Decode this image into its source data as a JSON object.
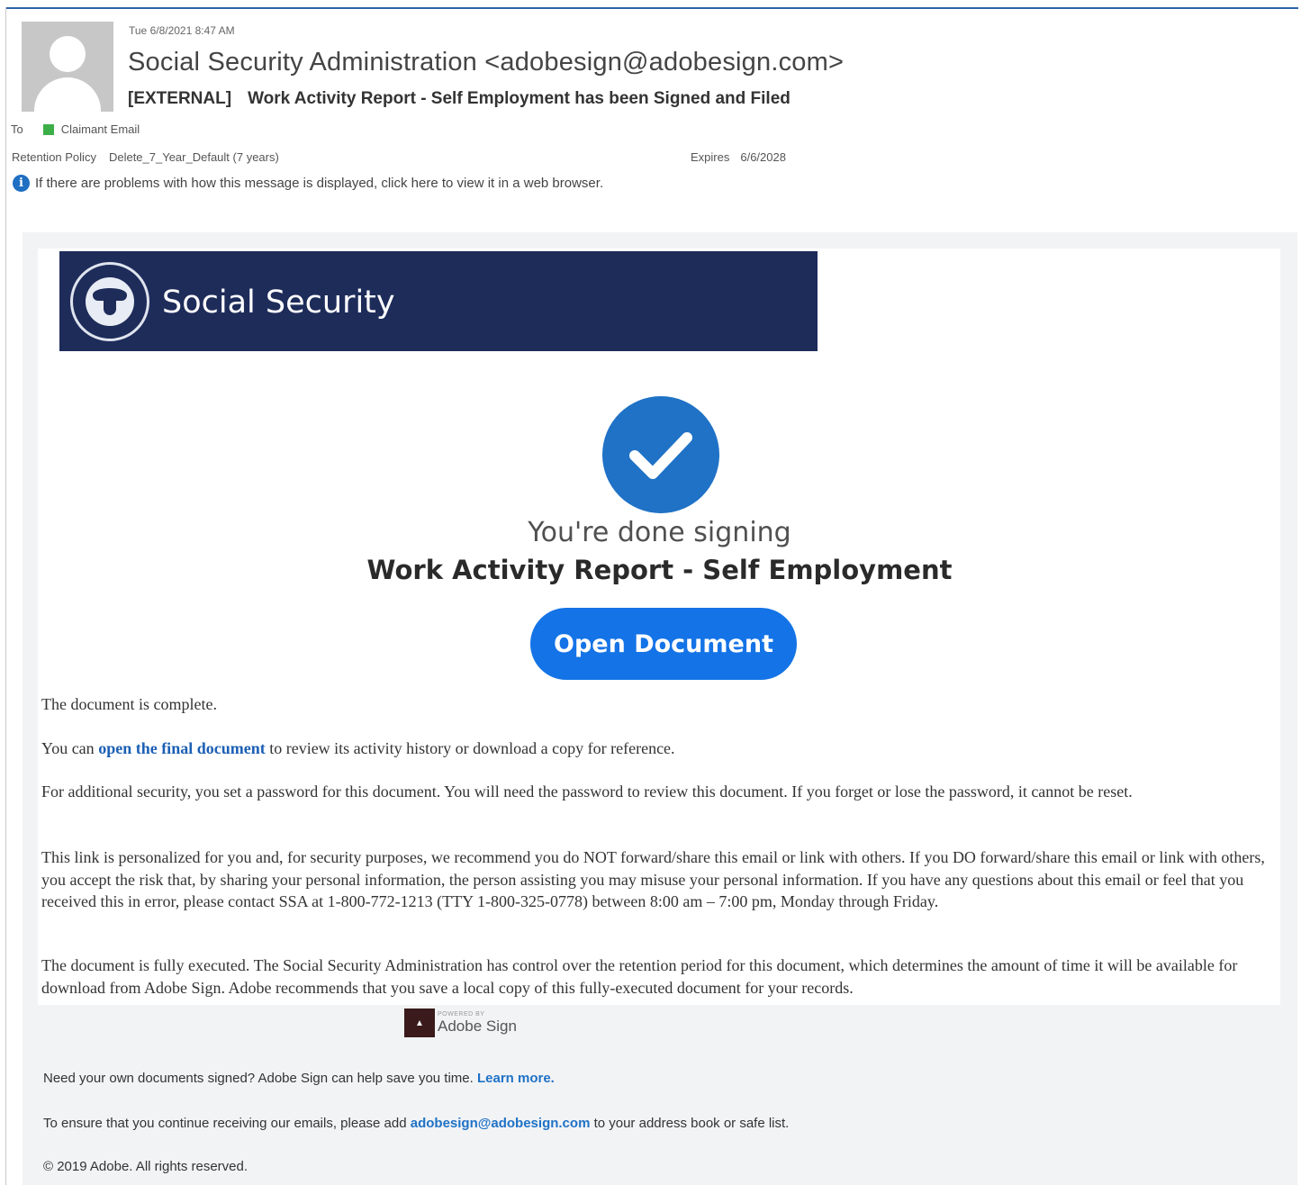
{
  "email": {
    "date": "Tue 6/8/2021 8:47 AM",
    "from": "Social Security Administration <adobesign@adobesign.com>",
    "subject_tag": "[EXTERNAL]",
    "subject": "Work Activity Report - Self Employment has been Signed and Filed",
    "to_label": "To",
    "to_value": "Claimant Email",
    "retention_label": "Retention Policy",
    "retention_value": "Delete_7_Year_Default (7 years)",
    "expires_label": "Expires",
    "expires_value": "6/6/2028",
    "info_text": "If there are problems with how this message is displayed, click here to view it in a web browser."
  },
  "banner": {
    "title": "Social Security"
  },
  "status": {
    "done_text": "You're done signing",
    "doc_title": "Work Activity Report - Self Employment",
    "open_button": "Open Document"
  },
  "body": {
    "p1": "The document is complete.",
    "p2_before": "You can ",
    "p2_link": "open the final document",
    "p2_after": " to review its activity history or download a copy for reference.",
    "p3": "For additional security, you set a password for this document. You will need the password to review this document. If you forget or lose the password, it cannot be reset.",
    "p4": "This link is personalized for you and, for security purposes, we recommend you do NOT forward/share this email or link with others. If you DO forward/share this email or link with others, you accept the risk that, by sharing your personal information, the person assisting you may misuse your personal information. If you have any questions about this email or feel that you received this in error, please contact SSA at 1-800-772-1213 (TTY 1-800-325-0778) between 8:00 am – 7:00 pm, Monday through Friday.",
    "p5": "The document is fully executed. The Social Security Administration has control over the retention period for this document, which determines the amount of time it will be available for download from Adobe Sign. Adobe recommends that you save a local copy of this fully-executed document for your records."
  },
  "footer": {
    "powered_by": "POWERED BY",
    "brand": "Adobe Sign",
    "need_text": "Need your own documents signed? Adobe Sign can help save you time. ",
    "learn_more": "Learn more.",
    "ensure_before": "To ensure that you continue receiving our emails, please add ",
    "ensure_link": "adobesign@adobesign.com",
    "ensure_after": " to your address book or safe list.",
    "copyright": "© 2019 Adobe. All rights reserved."
  },
  "colors": {
    "banner": "#1e2c5a",
    "accent": "#1473e6",
    "check": "#1f72c6",
    "link": "#1b5fb4"
  }
}
